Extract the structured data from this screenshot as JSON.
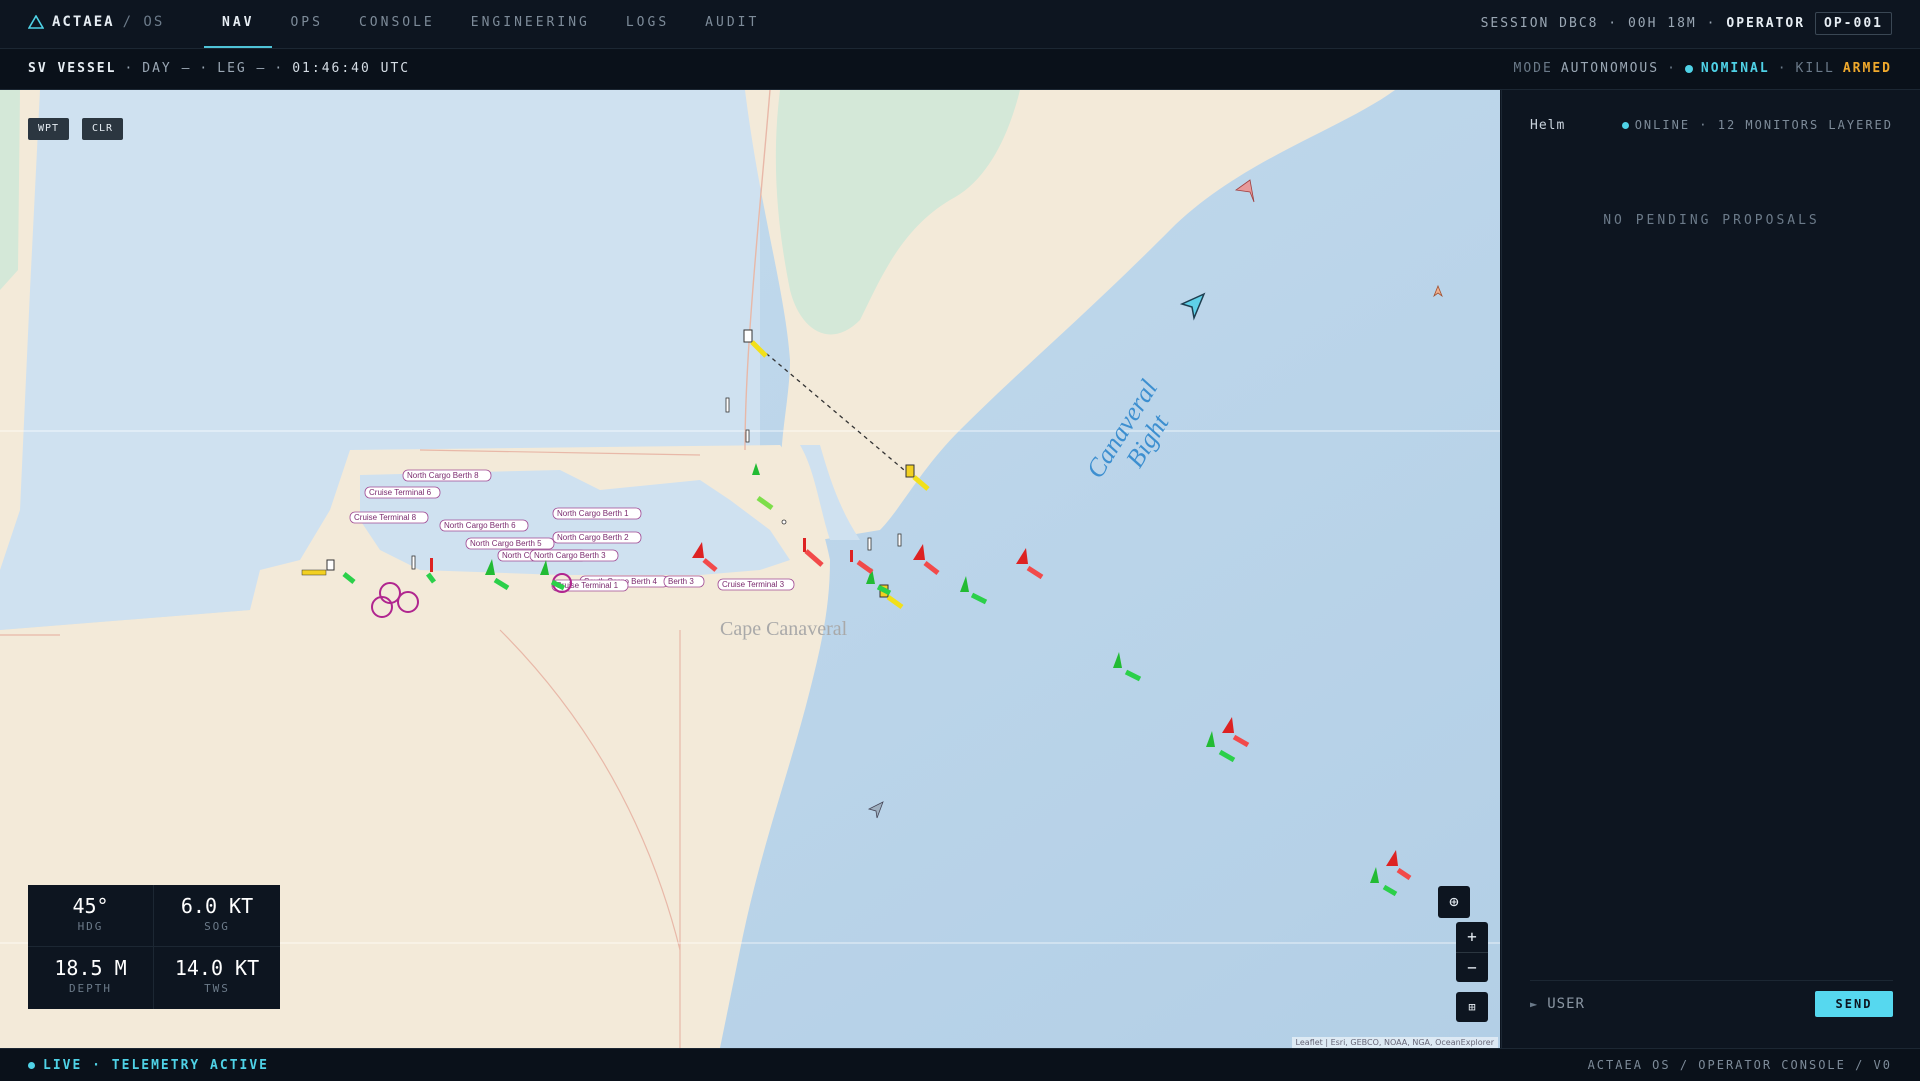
{
  "app": {
    "name": "ACTAEA",
    "sub": "/ OS"
  },
  "nav": {
    "tabs": [
      "NAV",
      "OPS",
      "CONSOLE",
      "ENGINEERING",
      "LOGS",
      "AUDIT"
    ],
    "active": "NAV"
  },
  "session": {
    "label": "SESSION DBC8 · 00H 18M ·",
    "operator_label": "OPERATOR",
    "operator_id": "OP-001"
  },
  "vessel_bar": {
    "name": "SV VESSEL",
    "day": "DAY —",
    "leg": "LEG —",
    "time": "01:46:40 UTC",
    "sep": "·"
  },
  "mode_bar": {
    "mode_label": "MODE",
    "mode_value": "AUTONOMOUS",
    "status": "NOMINAL",
    "kill_label": "KILL",
    "kill_value": "ARMED",
    "sep": "·"
  },
  "map": {
    "buttons": {
      "wpt": "WPT",
      "clr": "CLR"
    },
    "place_labels": {
      "cape": "Cape Canaveral",
      "bight_1": "Canaveral",
      "bight_2": "Bight"
    },
    "berth_labels": [
      "North Cargo Berth 8",
      "Cruise Terminal 6",
      "Cruise Terminal 8",
      "North Cargo Berth 6",
      "North Cargo Berth 5",
      "North Cargo Berth 4",
      "North Cargo Berth 3",
      "North Cargo Berth 1",
      "North Cargo Berth 2",
      "South Cargo Berth 4",
      "Berth 3",
      "Cruise Terminal 1",
      "Cruise Terminal 3"
    ],
    "attribution": "Leaflet | Esri, GEBCO, NOAA, NGA, OceanExplorer",
    "controls": {
      "zoom_in": "+",
      "zoom_out": "−",
      "locate": "⊕",
      "layers": "⊞"
    }
  },
  "instruments": [
    {
      "value": "45°",
      "label": "HDG"
    },
    {
      "value": "6.0 KT",
      "label": "SOG"
    },
    {
      "value": "18.5 M",
      "label": "DEPTH"
    },
    {
      "value": "14.0 KT",
      "label": "TWS"
    }
  ],
  "helm": {
    "title": "Helm",
    "status": "ONLINE · 12 MONITORS LAYERED",
    "empty": "NO PENDING PROPOSALS",
    "prompt": "►",
    "input_placeholder": "USER",
    "send_label": "SEND"
  },
  "footer": {
    "live": "LIVE · TELEMETRY ACTIVE",
    "right": "ACTAEA OS / OPERATOR CONSOLE / V0"
  },
  "colors": {
    "accent": "#4fd2e6",
    "warning": "#f0a92c",
    "bg": "#0d1520",
    "water": "#bcd6ea",
    "land": "#f3ead9",
    "starboard_mark": "#22bb33",
    "port_mark": "#dd2222"
  }
}
